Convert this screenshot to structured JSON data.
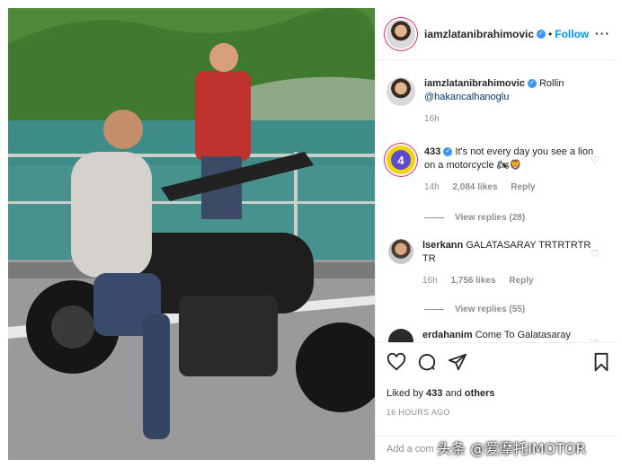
{
  "colors": {
    "accent": "#0095f6",
    "verified": "#3897f0",
    "muted": "#8e8e8e"
  },
  "post": {
    "author": "iamzlatanibrahimovic",
    "follow_label": "Follow",
    "more_icon": "ellipsis-icon",
    "caption": {
      "username": "iamzlatanibrahimovic",
      "text": "Rollin",
      "mention": "@hakancalhanoglu",
      "time": "16h"
    }
  },
  "comments": [
    {
      "username": "433",
      "text": "It's not every day you see a lion on a motorcycle 🏍🦁",
      "time": "14h",
      "likes": "2,084 likes",
      "reply": "Reply",
      "view_replies": "View replies (28)"
    },
    {
      "username": "lserkann",
      "text": "GALATASARAY TRTRTRTR TR",
      "time": "16h",
      "likes": "1,756 likes",
      "reply": "Reply",
      "view_replies": "View replies (55)"
    },
    {
      "username": "erdahanim",
      "text": "Come To Galatasaray"
    }
  ],
  "footer": {
    "liked_prefix": "Liked by",
    "liked_user": "433",
    "liked_and": "and",
    "liked_others": "others",
    "time_ago": "16 HOURS AGO",
    "add_comment_placeholder": "Add a com"
  },
  "watermark": "头条 @爱摩托IMOTOR"
}
